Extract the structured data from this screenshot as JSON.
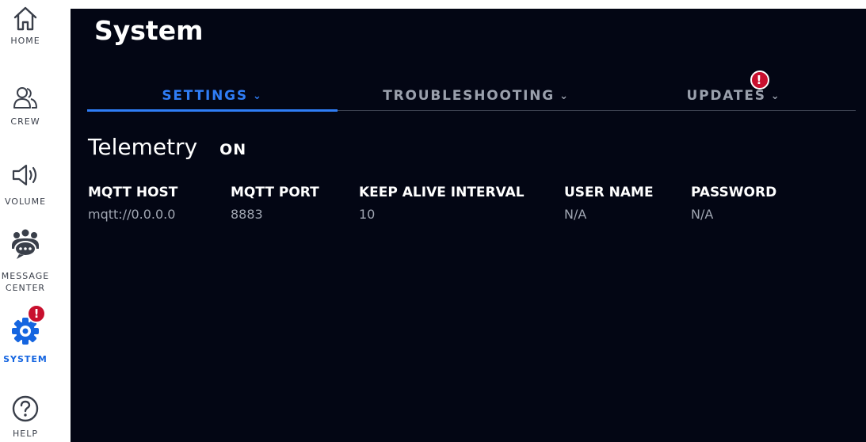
{
  "sidebar": {
    "items": [
      {
        "label": "HOME",
        "icon": "home-icon"
      },
      {
        "label": "CREW",
        "icon": "crew-icon"
      },
      {
        "label": "VOLUME",
        "icon": "volume-icon"
      },
      {
        "label": "MESSAGE CENTER",
        "icon": "message-center-icon"
      },
      {
        "label": "SYSTEM",
        "icon": "gear-icon",
        "active": true,
        "badge": "!"
      },
      {
        "label": "HELP",
        "icon": "help-icon"
      }
    ]
  },
  "page": {
    "title": "System"
  },
  "tabs": [
    {
      "label": "SETTINGS",
      "active": true
    },
    {
      "label": "TROUBLESHOOTING"
    },
    {
      "label": "UPDATES",
      "badge": "!"
    }
  ],
  "telemetry": {
    "title": "Telemetry",
    "state": "ON"
  },
  "fields": [
    {
      "label": "MQTT HOST",
      "value": "mqtt://0.0.0.0"
    },
    {
      "label": "MQTT PORT",
      "value": "8883"
    },
    {
      "label": "KEEP ALIVE INTERVAL",
      "value": "10"
    },
    {
      "label": "USER NAME",
      "value": "N/A"
    },
    {
      "label": "PASSWORD",
      "value": "N/A"
    }
  ],
  "colors": {
    "accent": "#2f7df6",
    "badge": "#c8102e",
    "panel_bg": "#030614",
    "sidebar_active": "#1565e0"
  }
}
